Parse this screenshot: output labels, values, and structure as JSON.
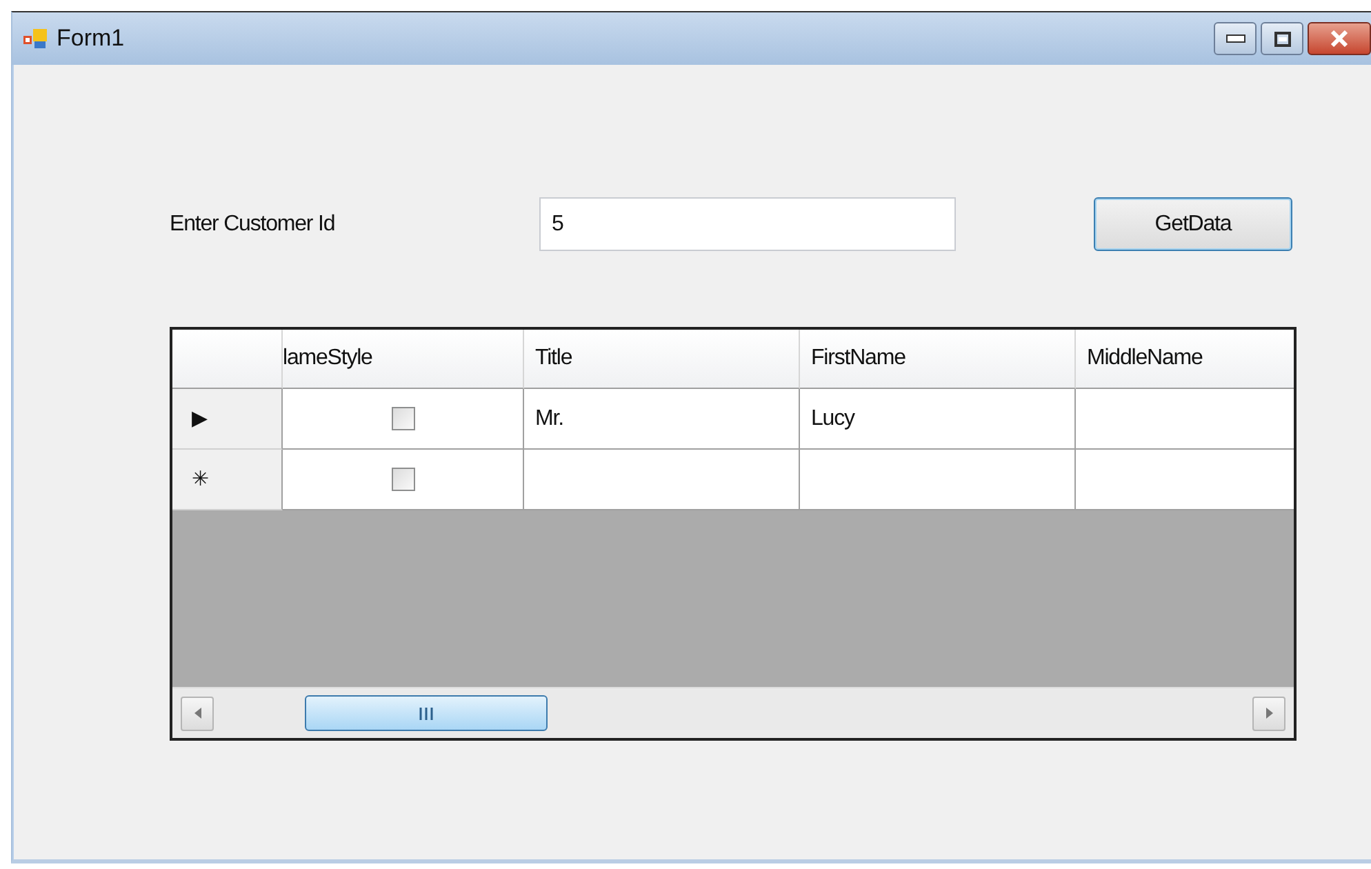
{
  "window": {
    "title": "Form1"
  },
  "form": {
    "label": "Enter Customer Id",
    "customer_id": "5",
    "button": "GetData"
  },
  "grid": {
    "columns": [
      "lameStyle",
      "Title",
      "FirstName",
      "MiddleName"
    ],
    "rows": [
      {
        "indicator": "▶",
        "name_style_checked": false,
        "title": "Mr.",
        "first_name": "Lucy"
      },
      {
        "indicator": "✳",
        "name_style_checked": false
      }
    ]
  }
}
